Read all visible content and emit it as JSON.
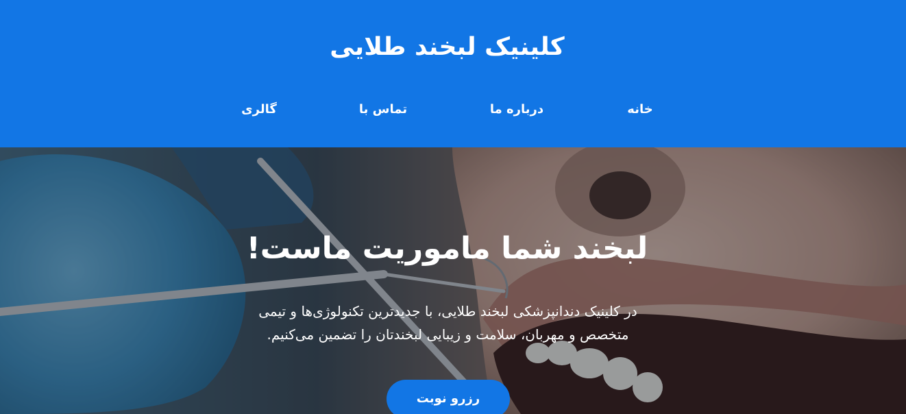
{
  "header": {
    "title": "کلینیک لبخند طلایی",
    "nav": [
      {
        "label": "خانه"
      },
      {
        "label": "درباره ما"
      },
      {
        "label": "تماس با"
      },
      {
        "label": "گالری"
      }
    ]
  },
  "hero": {
    "title": "لبخند شما ماموریت ماست!",
    "description": "در کلینیک دندانپزشکی لبخند طلایی، با جدیدترین تکنولوژی‌ها و تیمی متخصص و مهربان، سلامت و زیبایی لبخندتان را تضمین می‌کنیم.",
    "cta_label": "رزرو نوبت",
    "image": "dental-examination-photo"
  },
  "colors": {
    "brand": "#1276e5",
    "text_on_brand": "#ffffff"
  }
}
